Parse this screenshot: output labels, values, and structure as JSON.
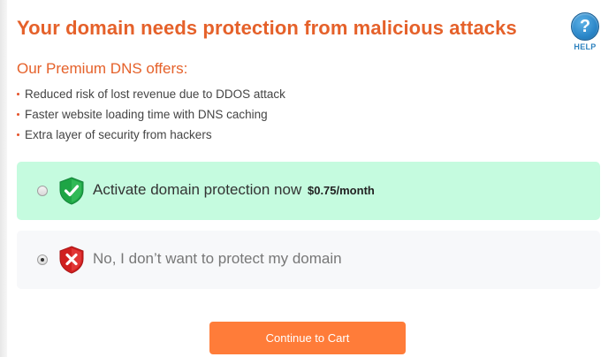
{
  "header": {
    "title": "Your domain needs protection from malicious attacks",
    "help": {
      "icon": "help-icon",
      "glyph": "?",
      "label": "HELP"
    }
  },
  "offer": {
    "heading": "Our Premium DNS offers:",
    "benefits": [
      "Reduced risk of lost revenue due to DDOS attack",
      "Faster website loading time with DNS caching",
      "Extra layer of security from hackers"
    ]
  },
  "options": [
    {
      "label": "Activate domain protection now",
      "price": "$0.75/month",
      "selected": false,
      "icon": "shield-check-icon",
      "background": "#c5fbdf"
    },
    {
      "label": "No, I don’t want to protect my domain",
      "selected": true,
      "icon": "shield-x-icon",
      "background": "#f7f8fa"
    }
  ],
  "actions": {
    "continue_label": "Continue to Cart"
  },
  "colors": {
    "accent": "#e5612a",
    "button": "#ff7c39",
    "help": "#2a86c8",
    "shield_ok": "#1ea545",
    "shield_bad": "#d01f1f"
  }
}
